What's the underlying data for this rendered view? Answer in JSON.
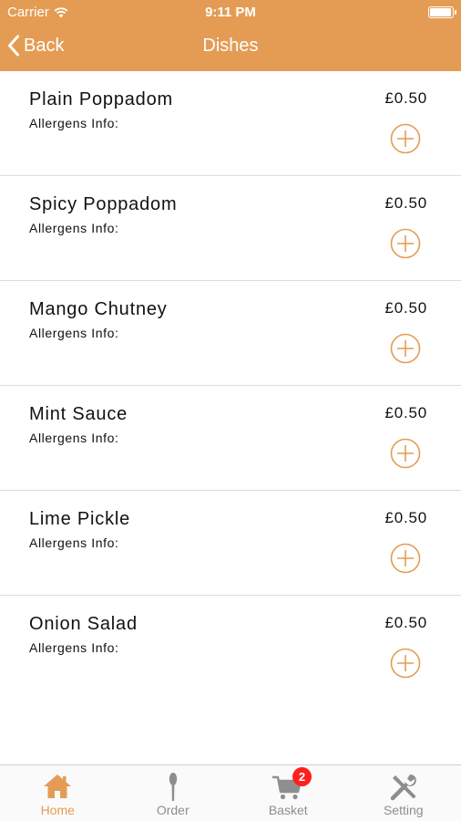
{
  "status_bar": {
    "carrier": "Carrier",
    "time": "9:11 PM",
    "battery_level": 0.95
  },
  "nav": {
    "back_label": "Back",
    "title": "Dishes"
  },
  "dishes": [
    {
      "name": "Plain Poppadom",
      "allergens_label": "Allergens Info:",
      "price": "£0.50"
    },
    {
      "name": "Spicy Poppadom",
      "allergens_label": "Allergens Info:",
      "price": "£0.50"
    },
    {
      "name": "Mango Chutney",
      "allergens_label": "Allergens Info:",
      "price": "£0.50"
    },
    {
      "name": "Mint Sauce",
      "allergens_label": "Allergens Info:",
      "price": "£0.50"
    },
    {
      "name": "Lime Pickle",
      "allergens_label": "Allergens Info:",
      "price": "£0.50"
    },
    {
      "name": "Onion Salad",
      "allergens_label": "Allergens Info:",
      "price": "£0.50"
    }
  ],
  "tabs": [
    {
      "label": "Home",
      "icon": "home-icon",
      "active": true
    },
    {
      "label": "Order",
      "icon": "spoon-icon",
      "active": false
    },
    {
      "label": "Basket",
      "icon": "cart-icon",
      "active": false,
      "badge": "2"
    },
    {
      "label": "Setting",
      "icon": "tools-icon",
      "active": false
    }
  ],
  "colors": {
    "accent": "#e49c54",
    "badge": "#ff1f1f",
    "tab_inactive": "#8e8e8e"
  }
}
